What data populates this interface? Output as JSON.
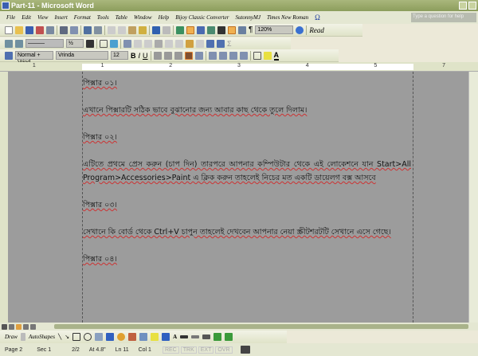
{
  "window": {
    "title": "Part-11 - Microsoft Word"
  },
  "menu": {
    "items": [
      "File",
      "Edit",
      "View",
      "Insert",
      "Format",
      "Tools",
      "Table",
      "Window",
      "Help",
      "Bijoy Classic Converter",
      "SutonnyMJ",
      "Times New Roman",
      "Ω"
    ],
    "help_placeholder": "Type a question for help"
  },
  "standard_toolbar": {
    "zoom": "120%",
    "read_label": "Read"
  },
  "tables_toolbar": {
    "line_weight": "½"
  },
  "formatting_toolbar": {
    "style": "Normal + Vrind",
    "font": "Vrinda",
    "size": "12",
    "bold": "B",
    "italic": "I",
    "underline": "U",
    "font_color_label": "A"
  },
  "ruler": {
    "ticks": [
      "1",
      "1",
      "2",
      "3",
      "4",
      "5",
      "7"
    ]
  },
  "document": {
    "paragraphs": [
      "পিক্সার ০১।",
      "এখানে পিক্সারটি সঠিক ভাবে বুঝানোর জন্য আবার কাছ থেকে তুলে দিলাম।",
      "পিক্সার ০২।",
      "এটিতে প্রথমে প্রেস করুন (চাপ দিন) তারপরে আপনার কম্পিউটার থেকে এই লোকেশনে যান Start>All Program>Accessories>Paint এ ক্লিক করুন তাহলেই নিচের মত একটি ডায়েলগ বক্স আসবে",
      "পিক্সার ০৩।",
      "সেখানে কি বোর্ড থেকে Ctrl+V চাপুন তাহলেই দেখবেন আপনার নেয়া স্ক্রীটশরটটি সেখানে এসে গেছে।",
      "পিক্সার ০৪।"
    ]
  },
  "drawing_toolbar": {
    "draw": "Draw",
    "autoshapes": "AutoShapes"
  },
  "status": {
    "page": "Page 2",
    "sec": "Sec 1",
    "pages": "2/2",
    "at": "At 4.8\"",
    "ln": "Ln 11",
    "col": "Col 1",
    "rec": "REC",
    "trk": "TRK",
    "ext": "EXT",
    "ovr": "OVR"
  }
}
